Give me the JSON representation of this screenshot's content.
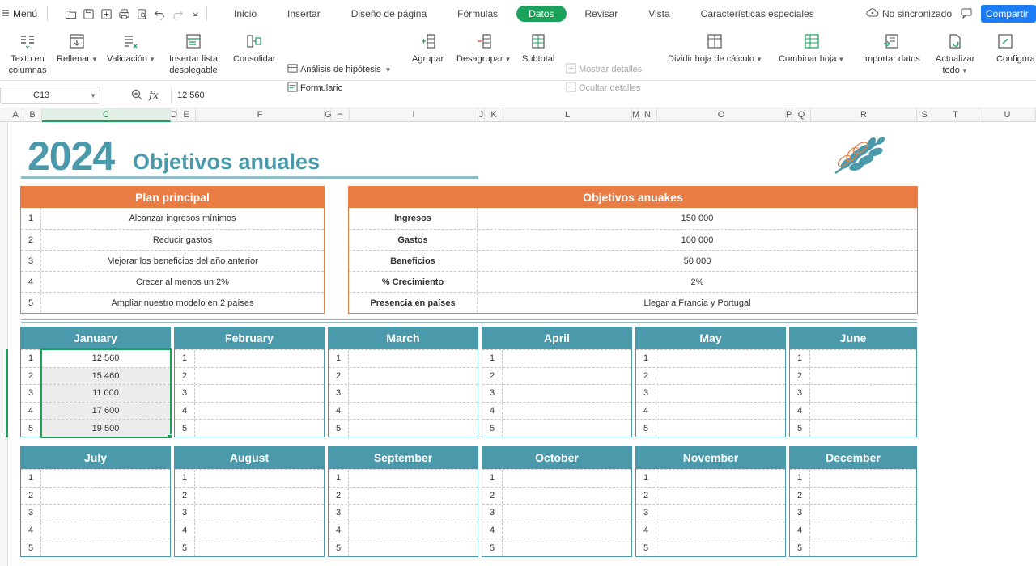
{
  "menubar": {
    "menu_label": "Menú",
    "tabs": [
      {
        "label": "Inicio",
        "active": false
      },
      {
        "label": "Insertar",
        "active": false
      },
      {
        "label": "Diseño de página",
        "active": false
      },
      {
        "label": "Fórmulas",
        "active": false
      },
      {
        "label": "Datos",
        "active": true
      },
      {
        "label": "Revisar",
        "active": false
      },
      {
        "label": "Vista",
        "active": false
      },
      {
        "label": "Características especiales",
        "active": false
      }
    ],
    "sync_status": "No sincronizado",
    "share_label": "Compartir"
  },
  "ribbon": {
    "text_to_columns": "Texto en\ncolumnas",
    "fill": "Rellenar",
    "validation": "Validación",
    "insert_dropdown": "Insertar lista\ndesplegable",
    "consolidate": "Consolidar",
    "what_if": "Análisis de hipótesis",
    "form": "Formulario",
    "group": "Agrupar",
    "ungroup": "Desagrupar",
    "subtotal": "Subtotal",
    "show_details": "Mostrar detalles",
    "hide_details": "Ocultar detalles",
    "split_sheet": "Dividir hoja de cálculo",
    "merge_sheet": "Combinar hoja",
    "import_data": "Importar datos",
    "refresh_all": "Actualizar\ntodo",
    "configure": "Configura"
  },
  "formula_bar": {
    "cell_ref": "C13",
    "fx": "fx",
    "value": "12 560"
  },
  "columns": [
    "A",
    "B",
    "C",
    "D",
    "E",
    "F",
    "G",
    "H",
    "I",
    "J",
    "K",
    "L",
    "M",
    "N",
    "O",
    "P",
    "Q",
    "R",
    "S",
    "T",
    "U"
  ],
  "sheet": {
    "year": "2024",
    "title": "Objetivos anuales",
    "plan": {
      "header": "Plan principal",
      "rows": [
        {
          "n": "1",
          "text": "Alcanzar ingresos mínimos"
        },
        {
          "n": "2",
          "text": "Reducir gastos"
        },
        {
          "n": "3",
          "text": "Mejorar los beneficios del año anterior"
        },
        {
          "n": "4",
          "text": "Crecer al menos un 2%"
        },
        {
          "n": "5",
          "text": "Ampliar nuestro modelo en 2 países"
        }
      ]
    },
    "goals": {
      "header": "Objetivos anuakes",
      "rows": [
        {
          "label": "Ingresos",
          "value": "150 000"
        },
        {
          "label": "Gastos",
          "value": "100 000"
        },
        {
          "label": "Beneficios",
          "value": "50 000"
        },
        {
          "label": "% Crecimiento",
          "value": "2%"
        },
        {
          "label": "Presencia en países",
          "value": "Llegar a Francia y Portugal"
        }
      ]
    },
    "months": [
      {
        "name": "January",
        "values": [
          "12 560",
          "15 460",
          "11 000",
          "17 600",
          "19 500"
        ]
      },
      {
        "name": "February",
        "values": [
          "",
          "",
          "",
          "",
          ""
        ]
      },
      {
        "name": "March",
        "values": [
          "",
          "",
          "",
          "",
          ""
        ]
      },
      {
        "name": "April",
        "values": [
          "",
          "",
          "",
          "",
          ""
        ]
      },
      {
        "name": "May",
        "values": [
          "",
          "",
          "",
          "",
          ""
        ]
      },
      {
        "name": "June",
        "values": [
          "",
          "",
          "",
          "",
          ""
        ]
      },
      {
        "name": "July",
        "values": [
          "",
          "",
          "",
          "",
          ""
        ]
      },
      {
        "name": "August",
        "values": [
          "",
          "",
          "",
          "",
          ""
        ]
      },
      {
        "name": "September",
        "values": [
          "",
          "",
          "",
          "",
          ""
        ]
      },
      {
        "name": "October",
        "values": [
          "",
          "",
          "",
          "",
          ""
        ]
      },
      {
        "name": "November",
        "values": [
          "",
          "",
          "",
          "",
          ""
        ]
      },
      {
        "name": "December",
        "values": [
          "",
          "",
          "",
          "",
          ""
        ]
      }
    ],
    "row_numbers": [
      "1",
      "2",
      "3",
      "4",
      "5"
    ]
  },
  "colors": {
    "accent_green": "#1aa25a",
    "teal": "#4a9aac",
    "orange": "#e97d44",
    "share_blue": "#1b7cf5"
  }
}
